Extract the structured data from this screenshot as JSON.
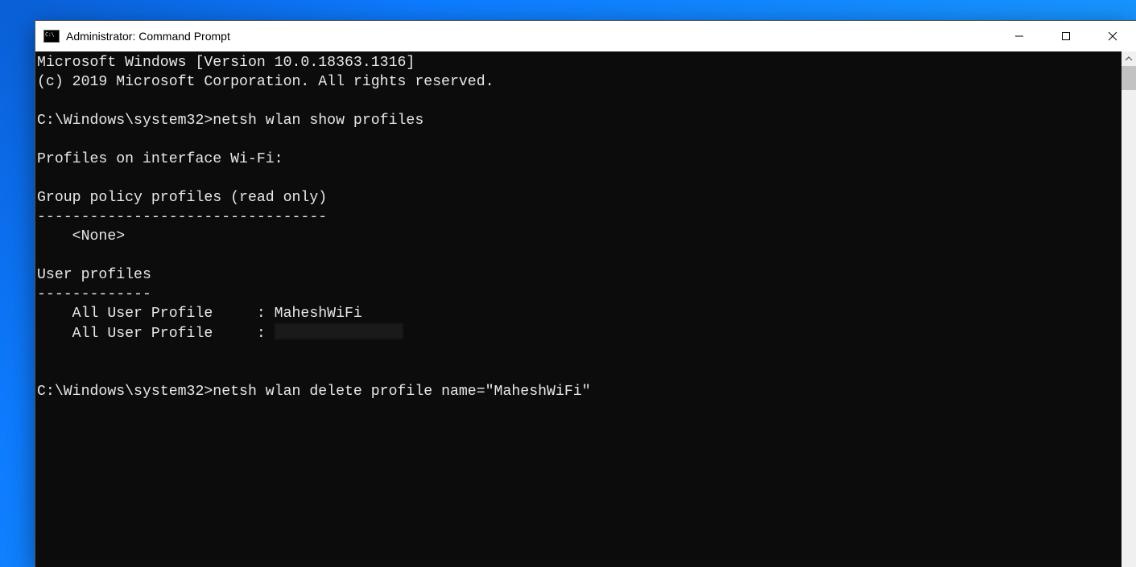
{
  "window": {
    "title": "Administrator: Command Prompt"
  },
  "console": {
    "line1": "Microsoft Windows [Version 10.0.18363.1316]",
    "line2": "(c) 2019 Microsoft Corporation. All rights reserved.",
    "blank": "",
    "prompt1_path": "C:\\Windows\\system32>",
    "cmd1": "netsh wlan show profiles",
    "header_interface": "Profiles on interface Wi-Fi:",
    "group_policy_header": "Group policy profiles (read only)",
    "divider_long": "---------------------------------",
    "none_entry": "    <None>",
    "user_profiles_header": "User profiles",
    "divider_short": "-------------",
    "profile1": "    All User Profile     : MaheshWiFi",
    "profile2_prefix": "    All User Profile     : ",
    "prompt2_path": "C:\\Windows\\system32>",
    "cmd2": "netsh wlan delete profile name=\"MaheshWiFi\""
  }
}
